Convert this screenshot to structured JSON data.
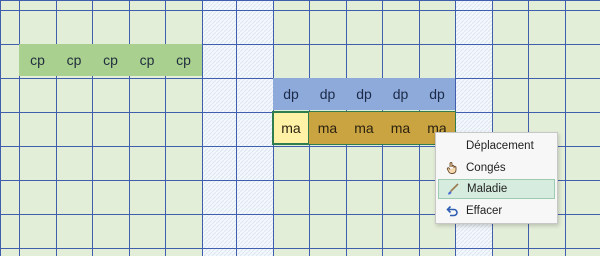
{
  "grid": {
    "line_color": "#3f5fae",
    "cell_fill": "#e3eed8",
    "hatch_fill": "#dbe8f2"
  },
  "cp_row": {
    "labels": [
      "cp",
      "cp",
      "cp",
      "cp",
      "cp"
    ],
    "color": "#a9d08e"
  },
  "dp_row": {
    "labels": [
      "dp",
      "dp",
      "dp",
      "dp",
      "dp"
    ],
    "color": "#8eaadb"
  },
  "ma_row": {
    "labels": [
      "ma",
      "ma",
      "ma",
      "ma",
      "ma"
    ],
    "color": "#c9a441",
    "selected_color": "#fff2a6"
  },
  "context_menu": {
    "items": [
      {
        "label": "Déplacement",
        "icon": "none"
      },
      {
        "label": "Congés",
        "icon": "hand-cursor-icon"
      },
      {
        "label": "Maladie",
        "icon": "brush-icon"
      },
      {
        "label": "Effacer",
        "icon": "undo-arrow-icon"
      }
    ]
  }
}
